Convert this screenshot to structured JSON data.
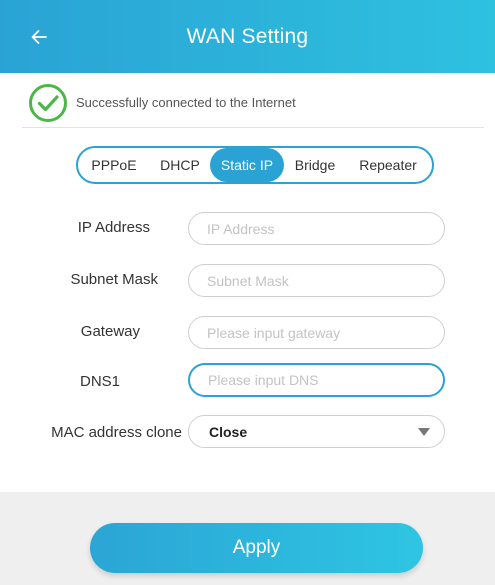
{
  "colors": {
    "accent": "#2aa3d4",
    "success": "#4cb648",
    "footer_bg": "#efefef"
  },
  "header": {
    "title": "WAN Setting",
    "back_icon": "arrow-left-icon"
  },
  "status": {
    "icon": "check-circle-icon",
    "text": "Successfully connected to the Internet"
  },
  "modes": {
    "tabs": [
      {
        "label": "PPPoE"
      },
      {
        "label": "DHCP"
      },
      {
        "label": "Static IP"
      },
      {
        "label": "Bridge"
      },
      {
        "label": "Repeater"
      }
    ],
    "selected": "Static IP"
  },
  "form": {
    "ip_address": {
      "label": "IP Address",
      "placeholder": "IP Address",
      "value": ""
    },
    "subnet_mask": {
      "label": "Subnet Mask",
      "placeholder": "Subnet Mask",
      "value": ""
    },
    "gateway": {
      "label": "Gateway",
      "placeholder": "Please input gateway",
      "value": ""
    },
    "dns1": {
      "label": "DNS1",
      "placeholder": "Please input DNS",
      "value": ""
    },
    "mac_clone": {
      "label": "MAC address clone",
      "value": "Close",
      "icon": "triangle-down-icon"
    }
  },
  "apply": {
    "label": "Apply"
  }
}
